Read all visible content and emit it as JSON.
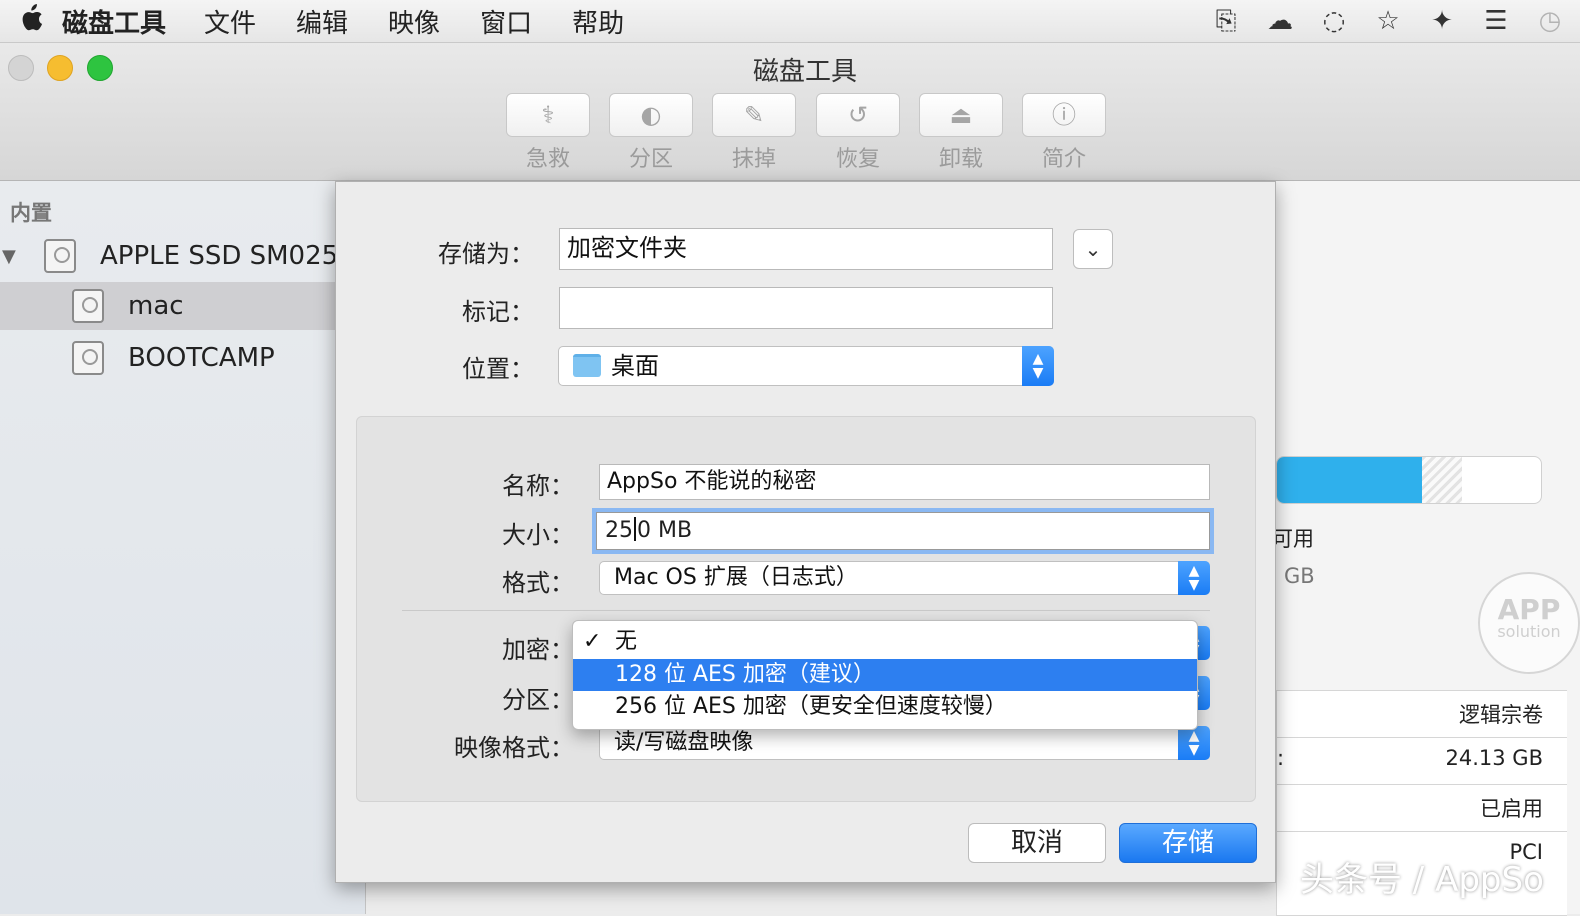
{
  "menubar": {
    "apple": "",
    "items": [
      "磁盘工具",
      "文件",
      "编辑",
      "映像",
      "窗口",
      "帮助"
    ],
    "status_icons": [
      "clipboard-icon",
      "wechat-icon",
      "chat-icon",
      "star-icon",
      "evernote-icon",
      "menu-lines-icon",
      "time-machine-icon"
    ]
  },
  "window": {
    "title": "磁盘工具",
    "toolbar": [
      {
        "label": "急救",
        "icon": "stethoscope-icon",
        "glyph": "⚕"
      },
      {
        "label": "分区",
        "icon": "partition-icon",
        "glyph": "◐"
      },
      {
        "label": "抹掉",
        "icon": "erase-icon",
        "glyph": "✎"
      },
      {
        "label": "恢复",
        "icon": "restore-icon",
        "glyph": "↺"
      },
      {
        "label": "卸载",
        "icon": "unmount-icon",
        "glyph": "⏏"
      },
      {
        "label": "简介",
        "icon": "info-icon",
        "glyph": "ⓘ"
      }
    ]
  },
  "sidebar": {
    "header": "内置",
    "items": [
      {
        "label": "APPLE SSD SM025..."
      },
      {
        "label": "mac"
      },
      {
        "label": "BOOTCAMP"
      }
    ]
  },
  "rightpane": {
    "available_label": "可用",
    "available_unit": "GB",
    "used_fraction": 0.55,
    "rows": [
      {
        "key": "",
        "value": "逻辑宗卷"
      },
      {
        "key": ":",
        "value": "24.13 GB"
      },
      {
        "key": "",
        "value": "已启用"
      },
      {
        "key": "",
        "value": "PCI"
      }
    ],
    "watermark_circle_1": "APP",
    "watermark_circle_2": "solution",
    "watermark": "头条号 / AppSo"
  },
  "dialog": {
    "save_as_label": "存储为：",
    "save_as_value": "加密文件夹",
    "tags_label": "标记：",
    "tags_value": "",
    "location_label": "位置：",
    "location_value": "桌面",
    "name_label": "名称：",
    "name_value": "AppSo 不能说的秘密",
    "size_label": "大小：",
    "size_value_before_caret": "25",
    "size_value_after_caret": "0 MB",
    "format_label": "格式：",
    "format_value": "Mac OS 扩展（日志式）",
    "encryption_label": "加密：",
    "partition_label": "分区：",
    "image_format_label": "映像格式：",
    "image_format_value": "读/写磁盘映像",
    "encryption_options": [
      {
        "label": "无",
        "checked": true
      },
      {
        "label": "128 位 AES 加密（建议）",
        "highlighted": true
      },
      {
        "label": "256 位 AES 加密（更安全但速度较慢）"
      }
    ],
    "cancel_label": "取消",
    "save_label": "存储"
  }
}
